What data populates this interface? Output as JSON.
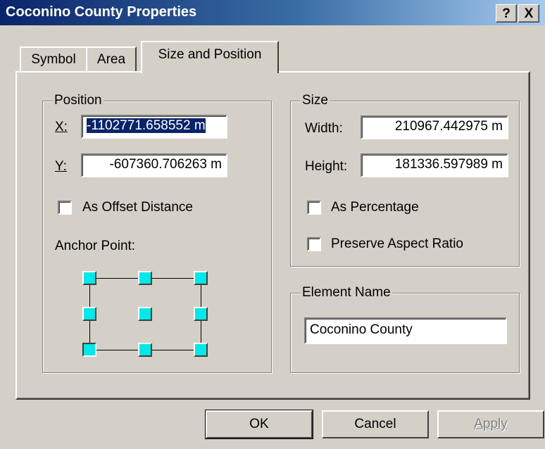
{
  "window": {
    "title": "Coconino County Properties",
    "help_label": "?",
    "close_label": "X"
  },
  "tabs": [
    {
      "label": "Symbol",
      "active": false
    },
    {
      "label": "Area",
      "active": false
    },
    {
      "label": "Size and Position",
      "active": true
    }
  ],
  "position": {
    "legend": "Position",
    "x_label": "X:",
    "x_value": "-1102771.658552 m",
    "y_label": "Y:",
    "y_value": "-607360.706263 m",
    "offset_label": "As Offset Distance",
    "offset_checked": false,
    "anchor_label": "Anchor Point:",
    "anchor_selected": "bottom-left"
  },
  "size": {
    "legend": "Size",
    "width_label": "Width:",
    "width_value": "210967.442975 m",
    "height_label": "Height:",
    "height_value": "181336.597989 m",
    "percentage_label": "As Percentage",
    "percentage_checked": false,
    "aspect_label": "Preserve Aspect Ratio",
    "aspect_checked": false
  },
  "element_name": {
    "legend": "Element Name",
    "value": "Coconino County"
  },
  "buttons": {
    "ok": "OK",
    "cancel": "Cancel",
    "apply": "Apply"
  },
  "colors": {
    "title_start": "#0a246a",
    "title_end": "#a6caf0",
    "anchor": "#00e8e8",
    "selection": "#0a246a"
  }
}
